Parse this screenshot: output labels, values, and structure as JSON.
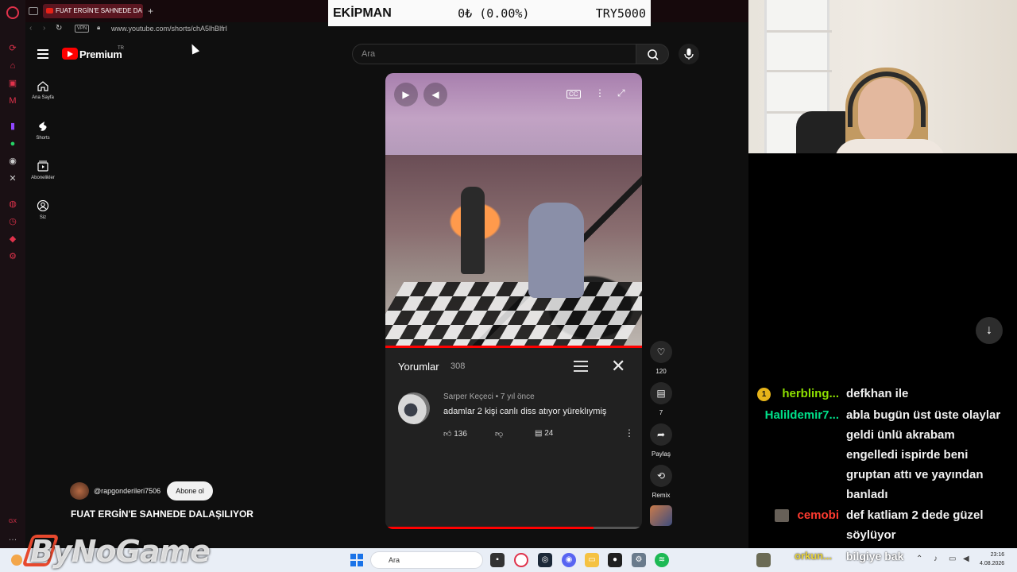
{
  "browser": {
    "tab_title": "FUAT ERGİN'E SAHNEDE DA",
    "new_tab": "+",
    "url": "www.youtube.com/shorts/chA5lhBlfrI",
    "vpn_label": "VPN"
  },
  "overlay": {
    "left": "EKİPMAN",
    "middle": "0₺ (0.00%)",
    "right": "TRY5000"
  },
  "youtube": {
    "logo_text": "Premium",
    "region": "TR",
    "search_placeholder": "Ara",
    "nav": [
      {
        "label": "Ana Sayfa",
        "icon": "home-icon"
      },
      {
        "label": "Shorts",
        "icon": "shorts-icon"
      },
      {
        "label": "Abonelikler",
        "icon": "subscriptions-icon"
      },
      {
        "label": "Siz",
        "icon": "you-icon"
      }
    ],
    "comments": {
      "title": "Yorumlar",
      "count": "308",
      "author": "Sarper Keçeci",
      "age": "7 yıl önce",
      "text": "adamlar 2 kişi canlı diss atıyor yüreklıymiş",
      "likes": "136",
      "replies": "24"
    },
    "actions": {
      "likes": "120",
      "comments": "7",
      "share": "Paylaş",
      "remix": "Remix"
    },
    "channel": "@rapgonderileri7506",
    "subscribe": "Abone ol",
    "title": "FUAT ERGİN'E SAHNEDE DALAŞILIYOR"
  },
  "chat": [
    {
      "user": "herbling...",
      "user_color": "#8ee000",
      "badge": "1",
      "lines": [
        "defkhan ile"
      ]
    },
    {
      "user": "Halildemir7...",
      "user_color": "#00e08a",
      "lines": [
        "abla bugün üst üste olaylar",
        "geldi ünlü akrabam",
        "engelledi ispirde beni",
        "gruptan attı ve yayından",
        "banladı"
      ]
    },
    {
      "user": "cemobi",
      "user_color": "#ff3b30",
      "lines": [
        "def katliam 2 dede güzel",
        "söylüyor"
      ]
    }
  ],
  "stream_overlay": {
    "watermark": "ByNoGame",
    "ticker_user": "orkun...",
    "ticker_msg": "bilgiye bak"
  },
  "taskbar": {
    "search_placeholder": "Ara",
    "time": "23:16",
    "date": "4.08.2026"
  }
}
